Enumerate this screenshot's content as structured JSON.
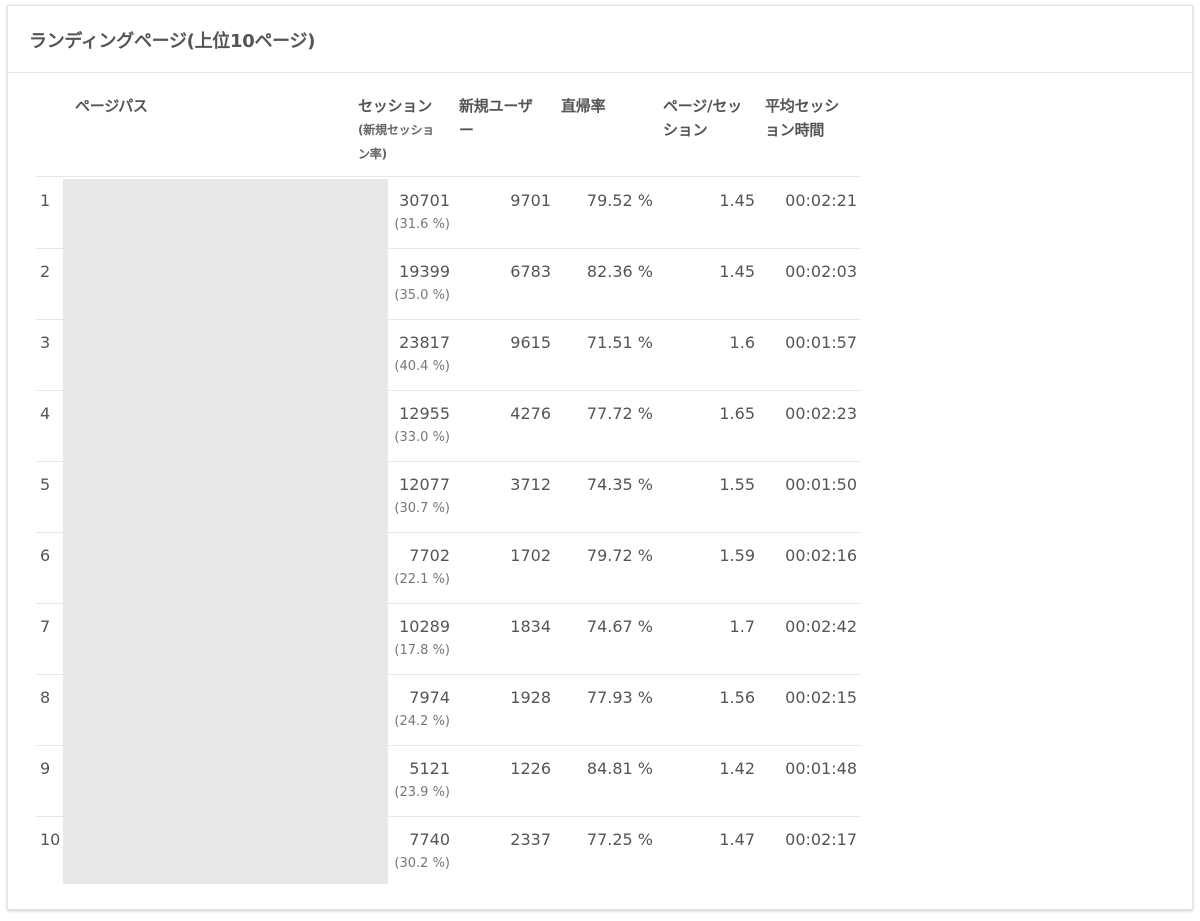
{
  "panel": {
    "title": "ランディングページ(上位10ページ)"
  },
  "table": {
    "headers": {
      "page_path": "ページパス",
      "sessions": "セッション",
      "sessions_sub_line1": "(新規セッショ",
      "sessions_sub_line2": "ン率)",
      "new_users_line1": "新規ユーザ",
      "new_users_line2": "ー",
      "bounce_rate": "直帰率",
      "pages_per_session_line1": "ページ/セッ",
      "pages_per_session_line2": "ション",
      "avg_duration_line1": "平均セッシ",
      "avg_duration_line2": "ョン時間"
    },
    "rows": [
      {
        "index": "1",
        "sessions": "30701",
        "new_session_rate": "(31.6 %)",
        "new_users": "9701",
        "bounce_rate": "79.52 %",
        "pages_per_session": "1.45",
        "avg_duration": "00:02:21"
      },
      {
        "index": "2",
        "sessions": "19399",
        "new_session_rate": "(35.0 %)",
        "new_users": "6783",
        "bounce_rate": "82.36 %",
        "pages_per_session": "1.45",
        "avg_duration": "00:02:03"
      },
      {
        "index": "3",
        "sessions": "23817",
        "new_session_rate": "(40.4 %)",
        "new_users": "9615",
        "bounce_rate": "71.51 %",
        "pages_per_session": "1.6",
        "avg_duration": "00:01:57"
      },
      {
        "index": "4",
        "sessions": "12955",
        "new_session_rate": "(33.0 %)",
        "new_users": "4276",
        "bounce_rate": "77.72 %",
        "pages_per_session": "1.65",
        "avg_duration": "00:02:23"
      },
      {
        "index": "5",
        "sessions": "12077",
        "new_session_rate": "(30.7 %)",
        "new_users": "3712",
        "bounce_rate": "74.35 %",
        "pages_per_session": "1.55",
        "avg_duration": "00:01:50"
      },
      {
        "index": "6",
        "sessions": "7702",
        "new_session_rate": "(22.1 %)",
        "new_users": "1702",
        "bounce_rate": "79.72 %",
        "pages_per_session": "1.59",
        "avg_duration": "00:02:16"
      },
      {
        "index": "7",
        "sessions": "10289",
        "new_session_rate": "(17.8 %)",
        "new_users": "1834",
        "bounce_rate": "74.67 %",
        "pages_per_session": "1.7",
        "avg_duration": "00:02:42"
      },
      {
        "index": "8",
        "sessions": "7974",
        "new_session_rate": "(24.2 %)",
        "new_users": "1928",
        "bounce_rate": "77.93 %",
        "pages_per_session": "1.56",
        "avg_duration": "00:02:15"
      },
      {
        "index": "9",
        "sessions": "5121",
        "new_session_rate": "(23.9 %)",
        "new_users": "1226",
        "bounce_rate": "84.81 %",
        "pages_per_session": "1.42",
        "avg_duration": "00:01:48"
      },
      {
        "index": "10",
        "sessions": "7740",
        "new_session_rate": "(30.2 %)",
        "new_users": "2337",
        "bounce_rate": "77.25 %",
        "pages_per_session": "1.47",
        "avg_duration": "00:02:17"
      }
    ]
  }
}
